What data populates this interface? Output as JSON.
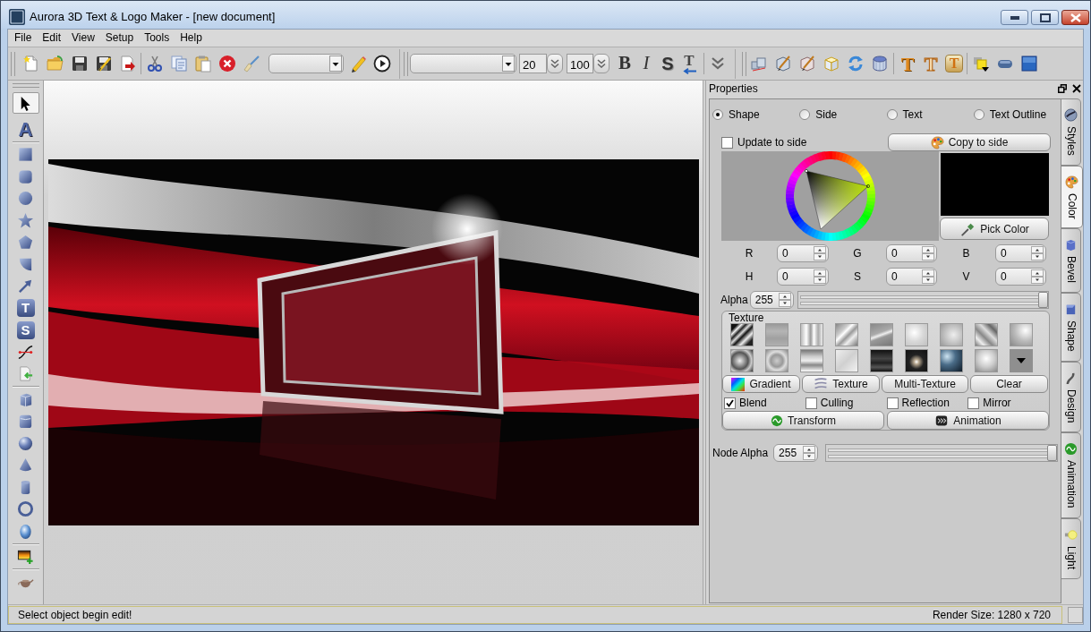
{
  "window": {
    "title": "Aurora 3D Text & Logo Maker - [new document]"
  },
  "menu": [
    "File",
    "Edit",
    "View",
    "Setup",
    "Tools",
    "Help"
  ],
  "toolbar": {
    "number_fields": [
      "20",
      "100"
    ],
    "style_buttons": [
      "B",
      "I",
      "S",
      "T"
    ],
    "letter_buttons": [
      "T",
      "T",
      "T"
    ]
  },
  "tool_groups": [
    [
      {
        "selected": true
      },
      {
        "glyph": "A",
        "selected": false
      }
    ],
    [
      {
        "selected": false
      },
      {
        "selected": false
      },
      {
        "selected": false
      },
      {
        "selected": false
      },
      {
        "selected": false
      },
      {
        "selected": false
      },
      {
        "selected": false
      },
      {
        "glyph": "T",
        "selected": false
      },
      {
        "glyph": "S",
        "selected": false
      },
      {
        "selected": false
      },
      {
        "selected": false
      }
    ],
    [
      {
        "selected": false
      },
      {
        "selected": false
      },
      {
        "selected": false
      },
      {
        "selected": false
      },
      {
        "selected": false
      },
      {
        "selected": false
      },
      {
        "selected": false
      }
    ],
    [
      {
        "selected": false
      }
    ],
    [
      {
        "selected": false
      }
    ]
  ],
  "properties": {
    "title": "Properties",
    "targets": [
      {
        "label": "Shape",
        "selected": true
      },
      {
        "label": "Side",
        "selected": false
      },
      {
        "label": "Text",
        "selected": false
      },
      {
        "label": "Text Outline",
        "selected": false
      }
    ],
    "update_to_side": {
      "label": "Update to side",
      "checked": false
    },
    "copy_button": "Copy to side",
    "pick_button": "Pick Color",
    "color_fields": [
      {
        "label": "R",
        "value": "0"
      },
      {
        "label": "G",
        "value": "0"
      },
      {
        "label": "B",
        "value": "0"
      },
      {
        "label": "H",
        "value": "0"
      },
      {
        "label": "S",
        "value": "0"
      },
      {
        "label": "V",
        "value": "0"
      }
    ],
    "alpha": {
      "label": "Alpha",
      "value": "255",
      "level": 1
    },
    "texture": {
      "title": "Texture",
      "buttons": [
        "Gradient",
        "Texture",
        "Multi-Texture",
        "Clear"
      ],
      "options": [
        {
          "label": "Blend",
          "checked": true
        },
        {
          "label": "Culling",
          "checked": false
        },
        {
          "label": "Reflection",
          "checked": false
        },
        {
          "label": "Mirror",
          "checked": false
        }
      ],
      "actions": [
        "Transform",
        "Animation"
      ]
    },
    "node_alpha": {
      "label": "Node Alpha",
      "value": "255",
      "level": 1
    }
  },
  "side_tabs": [
    {
      "label": "Styles",
      "selected": false
    },
    {
      "label": "Color",
      "selected": true
    },
    {
      "label": "Bevel",
      "selected": false
    },
    {
      "label": "Shape",
      "selected": false
    },
    {
      "label": "Design",
      "selected": false
    },
    {
      "label": "Animation",
      "selected": false
    },
    {
      "label": "Light",
      "selected": false
    }
  ],
  "status_bar": {
    "message": "Select object begin edit!",
    "render_size": "Render Size: 1280 x 720"
  }
}
